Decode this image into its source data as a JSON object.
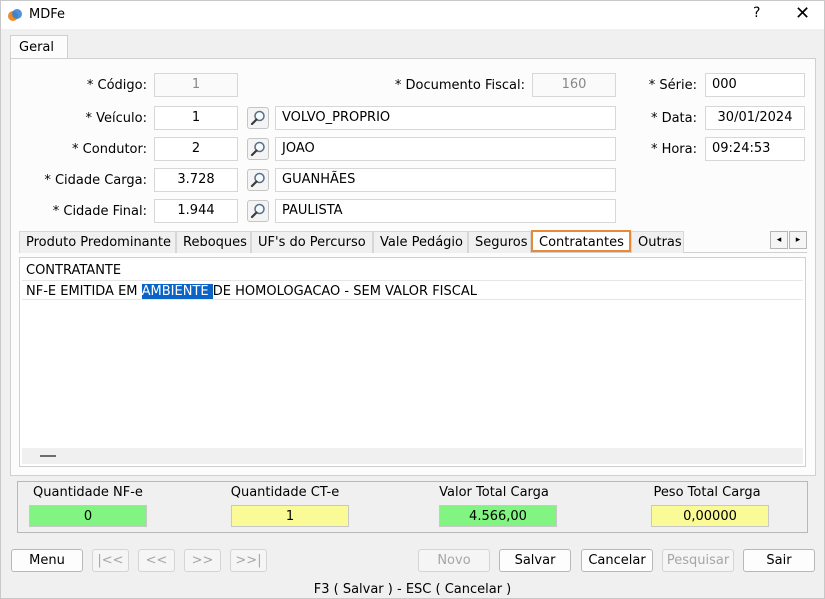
{
  "window": {
    "title": "MDFe",
    "help": "?",
    "close": "✕"
  },
  "main_tab": "Geral",
  "form": {
    "codigo": {
      "label": "* Código:",
      "value": "1"
    },
    "documento": {
      "label": "* Documento Fiscal:",
      "value": "160"
    },
    "serie": {
      "label": "* Série:",
      "value": "000"
    },
    "veiculo": {
      "label": "* Veículo:",
      "code": "1",
      "name": "VOLVO_PROPRIO"
    },
    "data": {
      "label": "* Data:",
      "value": "30/01/2024"
    },
    "condutor": {
      "label": "* Condutor:",
      "code": "2",
      "name": "JOAO"
    },
    "hora": {
      "label": "* Hora:",
      "value": "09:24:53"
    },
    "cidade_carga": {
      "label": "* Cidade Carga:",
      "code": "3.728",
      "name": "GUANHÃES"
    },
    "cidade_final": {
      "label": "* Cidade Final:",
      "code": "1.944",
      "name": "PAULISTA"
    }
  },
  "subtabs": [
    "Produto Predominante",
    "Reboques",
    "UF's do Percurso",
    "Vale Pedágio",
    "Seguros",
    "Contratantes",
    "Outras"
  ],
  "subtab_arrows": {
    "left": "◂",
    "right": "▸"
  },
  "grid": {
    "header": "CONTRATANTE",
    "row": {
      "before": "NF-E EMITIDA EM ",
      "selected": "AMBIENTE ",
      "after": "DE HOMOLOGACAO - SEM VALOR FISCAL"
    }
  },
  "summary": {
    "nfe": {
      "label": "Quantidade NF-e",
      "value": "0"
    },
    "cte": {
      "label": "Quantidade CT-e",
      "value": "1"
    },
    "valor": {
      "label": "Valor Total Carga",
      "value": "4.566,00"
    },
    "peso": {
      "label": "Peso Total Carga",
      "value": "0,00000"
    }
  },
  "buttons": {
    "menu": "Menu",
    "first": "|<<",
    "prev": "<<",
    "next": ">>",
    "last": ">>|",
    "novo": "Novo",
    "salvar": "Salvar",
    "cancelar": "Cancelar",
    "pesquisar": "Pesquisar",
    "sair": "Sair"
  },
  "footer_hint": "F3 ( Salvar )  -  ESC ( Cancelar )",
  "colors": {
    "accent_tab": "#e98a3a",
    "selection": "#0a64c8",
    "green": "#82f482",
    "yellow": "#fafa96"
  }
}
